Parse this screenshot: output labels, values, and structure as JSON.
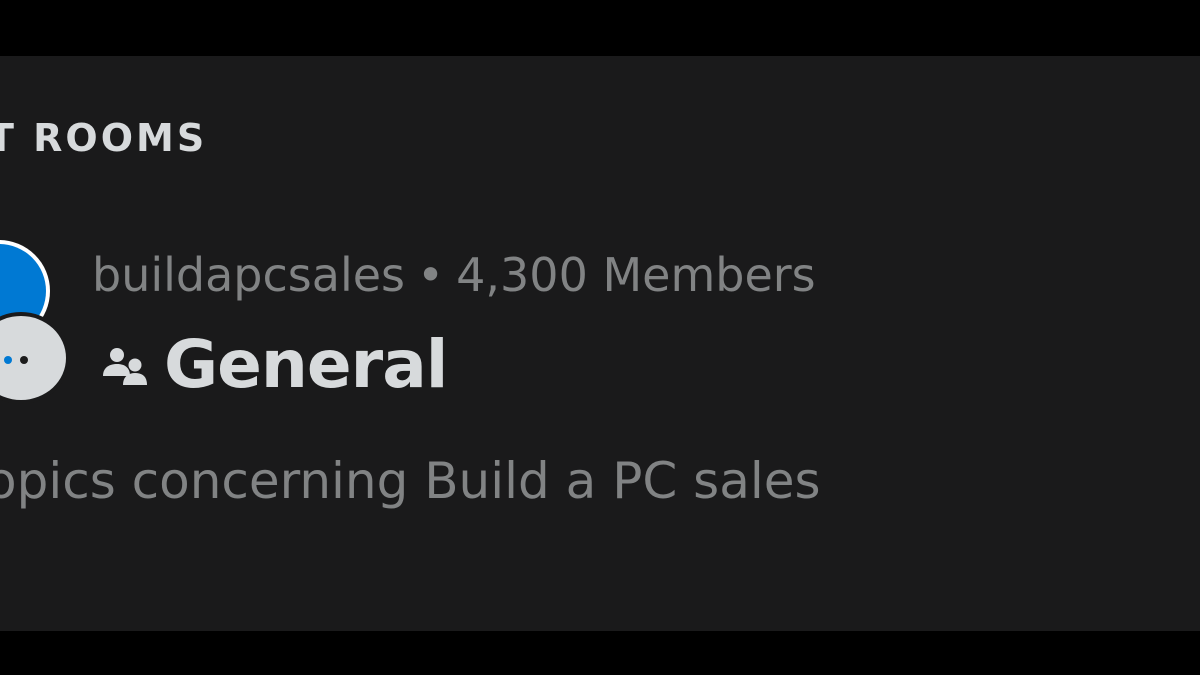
{
  "section": {
    "heading": "T ROOMS"
  },
  "room": {
    "community": "buildapcsales",
    "separator": "•",
    "members": "4,300 Members",
    "name": "General",
    "description": "opics concerning Build a PC sales",
    "avatar_icon": "community-avatar-icon",
    "badge_icon": "chat-bubble-icon",
    "type_icon": "people-icon"
  },
  "colors": {
    "background": "#000000",
    "panel": "#1a1a1b",
    "heading_text": "#d7dadc",
    "muted_text": "#818384",
    "avatar_blue": "#0079d3",
    "badge_gray": "#d7dadc"
  }
}
